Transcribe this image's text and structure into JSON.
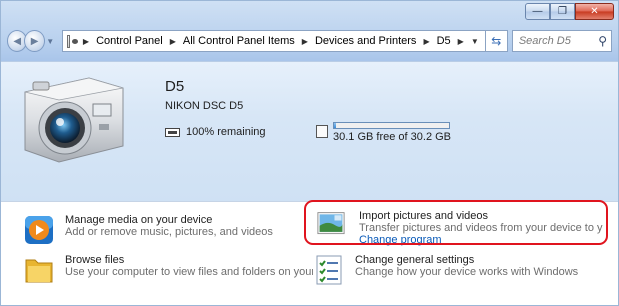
{
  "window": {
    "caption_buttons": [
      "—",
      "❐",
      "✕"
    ]
  },
  "nav": {
    "back_icon": "back-arrow-icon",
    "forward_icon": "forward-arrow-icon",
    "breadcrumbs": [
      "Control Panel",
      "All Control Panel Items",
      "Devices and Printers",
      "D5"
    ],
    "search_placeholder": "Search D5"
  },
  "device": {
    "name": "D5",
    "model": "NIKON DSC D5",
    "battery": "100% remaining",
    "storage_text": "30.1 GB free of 30.2 GB",
    "storage_used_fraction": 0.003
  },
  "tasks": [
    {
      "title": "Manage media on your device",
      "desc": "Add or remove music, pictures, and videos",
      "icon": "media-player-icon"
    },
    {
      "title": "Import pictures and videos",
      "desc": "Transfer pictures and videos from your device to your co...",
      "link": "Change program",
      "icon": "import-pictures-icon"
    },
    {
      "title": "Browse files",
      "desc": "Use your computer to view files and folders on your devi...",
      "icon": "folder-icon"
    },
    {
      "title": "Change general settings",
      "desc": "Change how your device works with Windows",
      "icon": "settings-checklist-icon"
    }
  ],
  "colors": {
    "highlight": "#e0141e",
    "link": "#0a5ab8"
  }
}
